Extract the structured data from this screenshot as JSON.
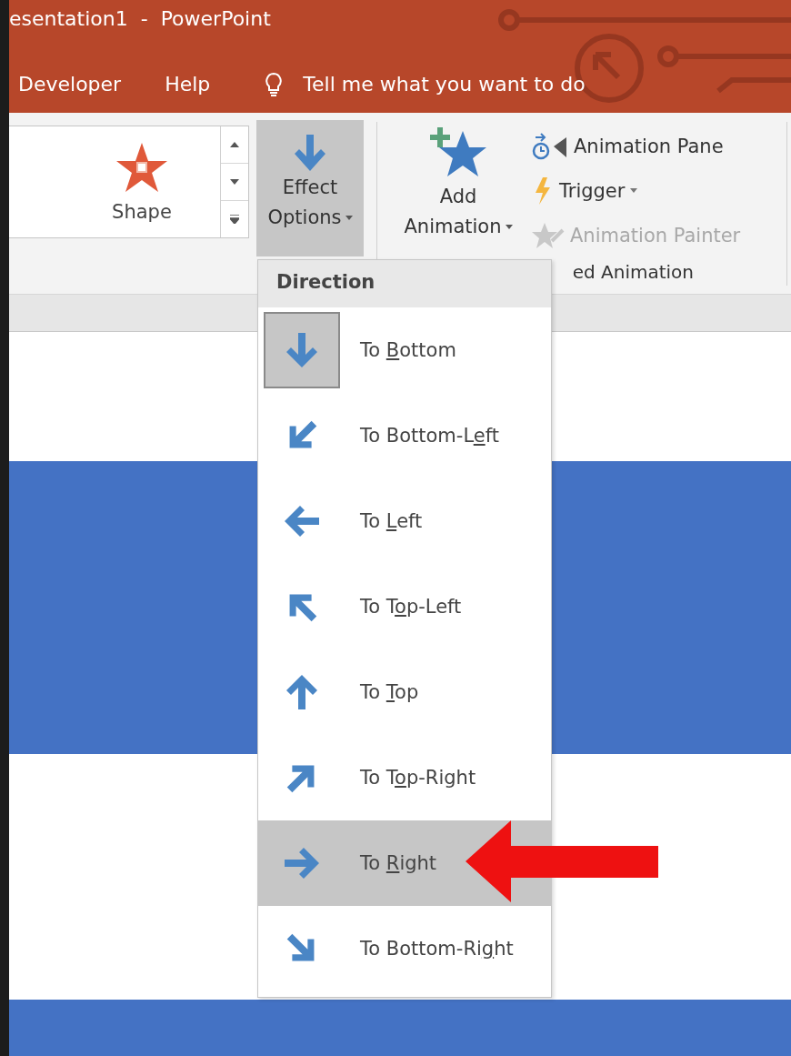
{
  "title_bar": {
    "title": "esentation1  -  PowerPoint"
  },
  "tabs": [
    {
      "label": "Developer",
      "selected": false
    },
    {
      "label": "Help",
      "selected": false
    }
  ],
  "tell_me": {
    "text": "Tell me what you want to do"
  },
  "ribbon": {
    "gallery": {
      "item_label": "Shape"
    },
    "effect_options": {
      "label_lines": [
        "Effect",
        "Options"
      ],
      "pressed": true
    },
    "add_animation": {
      "label_lines": [
        "Add",
        "Animation"
      ]
    },
    "commands": [
      {
        "kind": "pane",
        "label": "Animation Pane",
        "disabled": false,
        "dropdown": false
      },
      {
        "kind": "trigger",
        "label": "Trigger",
        "disabled": false,
        "dropdown": true
      },
      {
        "kind": "painter",
        "label": "Animation Painter",
        "disabled": true,
        "dropdown": false
      }
    ],
    "group_label": "ed Animation"
  },
  "direction_menu": {
    "header": "Direction",
    "items": [
      {
        "kind": "down",
        "before": "To ",
        "key": "B",
        "after": "ottom",
        "selected": true,
        "highlighted": false
      },
      {
        "kind": "down-left",
        "before": "To Bottom-L",
        "key": "e",
        "after": "ft",
        "selected": false,
        "highlighted": false
      },
      {
        "kind": "left",
        "before": "To ",
        "key": "L",
        "after": "eft",
        "selected": false,
        "highlighted": false
      },
      {
        "kind": "up-left",
        "before": "To T",
        "key": "o",
        "after": "p-Left",
        "selected": false,
        "highlighted": false
      },
      {
        "kind": "up",
        "before": "To ",
        "key": "T",
        "after": "op",
        "selected": false,
        "highlighted": false
      },
      {
        "kind": "up-right",
        "before": "To T",
        "key": "o",
        "after": "p-Right",
        "selected": false,
        "highlighted": false
      },
      {
        "kind": "right",
        "before": "To ",
        "key": "R",
        "after": "ight",
        "selected": false,
        "highlighted": true
      },
      {
        "kind": "down-right",
        "before": "To Bottom-Ri",
        "key": "g",
        "after": "ht",
        "selected": false,
        "highlighted": false
      }
    ]
  }
}
